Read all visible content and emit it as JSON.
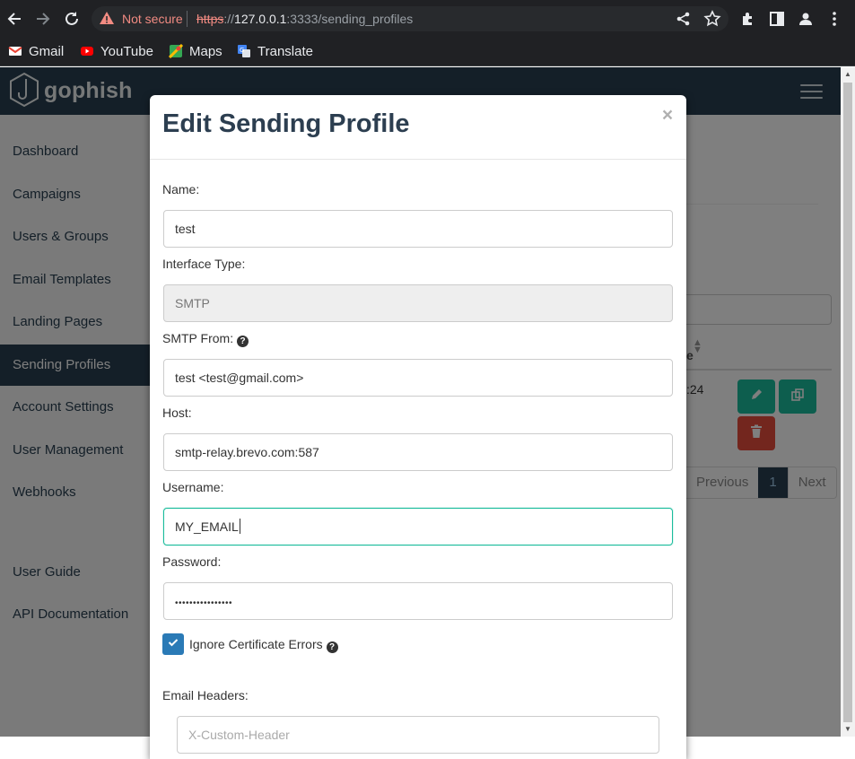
{
  "browser": {
    "security_label": "Not secure",
    "url_scheme": "https",
    "url_sep": "://",
    "url_host": "127.0.0.1",
    "url_path": ":3333/sending_profiles",
    "bookmarks": [
      {
        "label": "Gmail",
        "icon": "gmail-icon",
        "color": "#ea4335"
      },
      {
        "label": "YouTube",
        "icon": "youtube-icon",
        "color": "#ff0000"
      },
      {
        "label": "Maps",
        "icon": "maps-icon",
        "color": "#34a853"
      },
      {
        "label": "Translate",
        "icon": "translate-icon",
        "color": "#4285f4"
      }
    ]
  },
  "app": {
    "brand": "gophish",
    "colors": {
      "navbar": "#283f50",
      "accent": "#1abc9c",
      "danger": "#e74c3c",
      "primary": "#2a7ab6"
    }
  },
  "sidebar": {
    "items": [
      {
        "label": "Dashboard"
      },
      {
        "label": "Campaigns"
      },
      {
        "label": "Users & Groups"
      },
      {
        "label": "Email Templates"
      },
      {
        "label": "Landing Pages"
      },
      {
        "label": "Sending Profiles",
        "active": true
      },
      {
        "label": "Account Settings"
      },
      {
        "label": "User Management"
      },
      {
        "label": "Webhooks"
      }
    ],
    "bottom_items": [
      {
        "label": "User Guide"
      },
      {
        "label": "API Documentation"
      }
    ]
  },
  "background_table": {
    "header_fragment": "e",
    "cell_fragment": ":24",
    "pagination": {
      "previous": "Previous",
      "current": "1",
      "next": "Next"
    }
  },
  "modal": {
    "title": "Edit Sending Profile",
    "close_glyph": "×",
    "fields": {
      "name": {
        "label": "Name:",
        "value": "test"
      },
      "interface_type": {
        "label": "Interface Type:",
        "value": "SMTP"
      },
      "smtp_from": {
        "label": "SMTP From:",
        "value": "test <test@gmail.com>"
      },
      "host": {
        "label": "Host:",
        "value": "smtp-relay.brevo.com:587"
      },
      "username": {
        "label": "Username:",
        "value": "MY_EMAIL"
      },
      "password": {
        "label": "Password:",
        "value": "••••••••••••••••"
      }
    },
    "ignore_cert": {
      "label": "Ignore Certificate Errors",
      "checked": true
    },
    "email_headers": {
      "label": "Email Headers:",
      "placeholder": "X-Custom-Header"
    }
  }
}
